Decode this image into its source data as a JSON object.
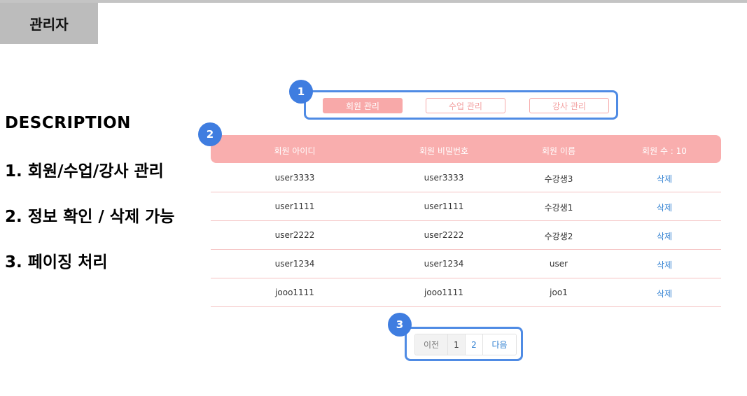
{
  "header": {
    "title": "관리자"
  },
  "description": {
    "title": "DESCRIPTION",
    "items": [
      "1. 회원/수업/강사 관리",
      "2. 정보 확인 / 삭제 가능",
      "3. 페이징 처리"
    ]
  },
  "badges": [
    "1",
    "2",
    "3"
  ],
  "tabs": [
    {
      "label": "회원 관리",
      "active": true
    },
    {
      "label": "수업 관리",
      "active": false
    },
    {
      "label": "강사 관리",
      "active": false
    }
  ],
  "table": {
    "headers": [
      "회원 아이디",
      "회원 비밀번호",
      "회원 이름",
      "회원 수 : 10"
    ],
    "delete_label": "삭제",
    "rows": [
      [
        "user3333",
        "user3333",
        "수강생3"
      ],
      [
        "user1111",
        "user1111",
        "수강생1"
      ],
      [
        "user2222",
        "user2222",
        "수강생2"
      ],
      [
        "user1234",
        "user1234",
        "user"
      ],
      [
        "jooo1111",
        "jooo1111",
        "joo1"
      ]
    ]
  },
  "pagination": {
    "prev": "이전",
    "pages": [
      "1",
      "2"
    ],
    "current_page": "1",
    "next": "다음"
  },
  "colors": {
    "accent_pink": "#f9aeae",
    "highlight_blue": "#4f8be4",
    "link_blue": "#2f7fd1"
  }
}
